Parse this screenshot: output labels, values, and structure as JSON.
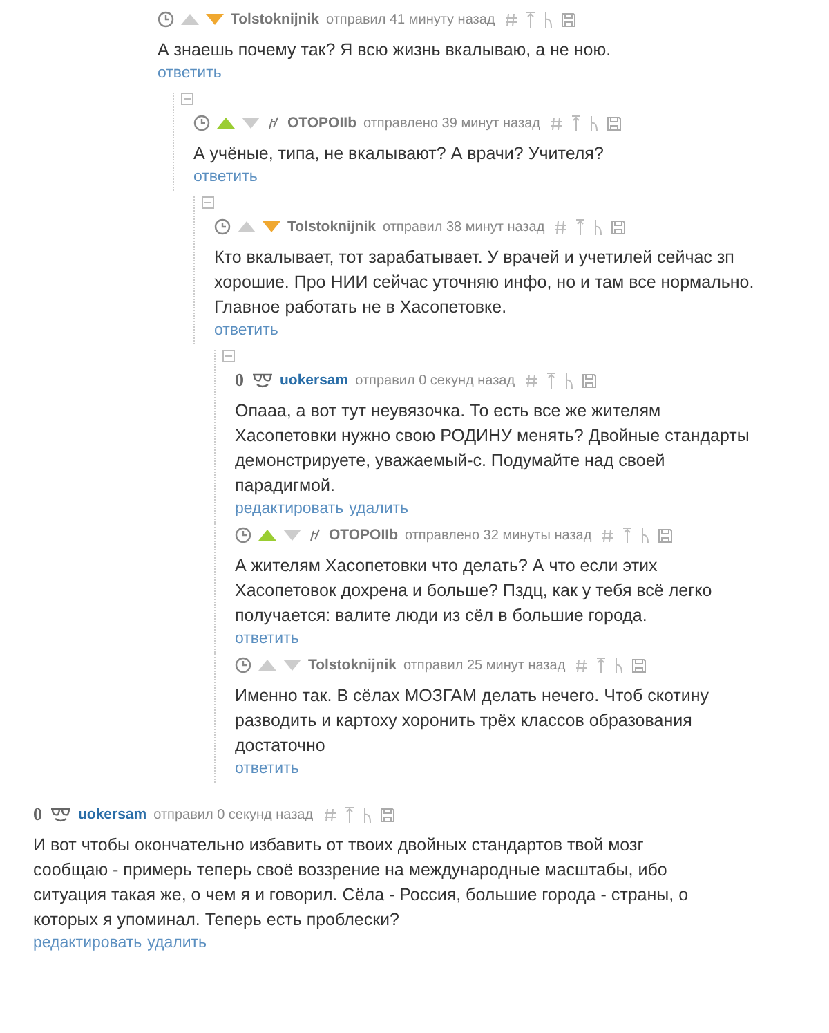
{
  "threads": [
    {
      "comments": [
        {
          "kind": "other",
          "up_voted": false,
          "down_voted": true,
          "badge": false,
          "author": "Tolstoknijnik",
          "meta": "отправил 41 минуту назад",
          "text": "А знаешь почему так? Я всю жизнь вкалываю, а не ною.",
          "actions": [
            "ответить"
          ],
          "children": [
            {
              "kind": "other",
              "up_voted": true,
              "down_voted": false,
              "badge": true,
              "author": "OTOPOIIb",
              "meta": "отправлено 39 минут назад",
              "text": "А учёные, типа, не вкалывают? А врачи? Учителя?",
              "actions": [
                "ответить"
              ],
              "children": [
                {
                  "kind": "other",
                  "up_voted": false,
                  "down_voted": true,
                  "badge": false,
                  "author": "Tolstoknijnik",
                  "meta": "отправил 38 минут назад",
                  "text": "Кто вкалывает, тот зарабатывает. У врачей и учетилей сейчас зп хорошие. Про НИИ сейчас уточняю инфо, но и там все нормально. Главное работать не в Хасопетовке.",
                  "actions": [
                    "ответить"
                  ],
                  "children": [
                    {
                      "kind": "own",
                      "rating": "0",
                      "author": "uokersam",
                      "meta": "отправил 0 секунд назад",
                      "text": "Опааа, а вот тут неувязочка. То есть все же жителям Хасопетовки нужно свою РОДИНУ менять? Двойные стандарты демонстрируете, уважаемый-с. Подумайте над своей парадигмой.",
                      "actions": [
                        "редактировать",
                        "удалить"
                      ]
                    },
                    {
                      "kind": "other",
                      "up_voted": true,
                      "down_voted": false,
                      "badge": true,
                      "author": "OTOPOIIb",
                      "meta": "отправлено 32 минуты назад",
                      "text": "А жителям Хасопетовки что делать? А что если этих Хасопетовок дохрена и больше? Пздц, как у тебя всё легко получается: валите люди из сёл в большие города.",
                      "actions": [
                        "ответить"
                      ]
                    },
                    {
                      "kind": "other",
                      "up_voted": false,
                      "down_voted": false,
                      "badge": false,
                      "author": "Tolstoknijnik",
                      "meta": "отправил 25 минут назад",
                      "text": "Именно так. В сёлах МОЗГАМ делать нечего. Чтоб скотину разводить и картоху хоронить трёх классов образования достаточно",
                      "actions": [
                        "ответить"
                      ]
                    }
                  ]
                }
              ]
            }
          ]
        }
      ]
    },
    {
      "comments": [
        {
          "kind": "own",
          "rating": "0",
          "author": "uokersam",
          "meta": "отправил 0 секунд назад",
          "text": "И вот чтобы окончательно избавить от твоих двойных стандартов твой мозг сообщаю - примерь теперь своё воззрение на международные масштабы, ибо ситуация такая же, о чем я и говорил. Сёла - Россия, большие города - страны, о которых я упоминал. Теперь есть проблески?",
          "actions": [
            "редактировать",
            "удалить"
          ]
        }
      ]
    }
  ]
}
